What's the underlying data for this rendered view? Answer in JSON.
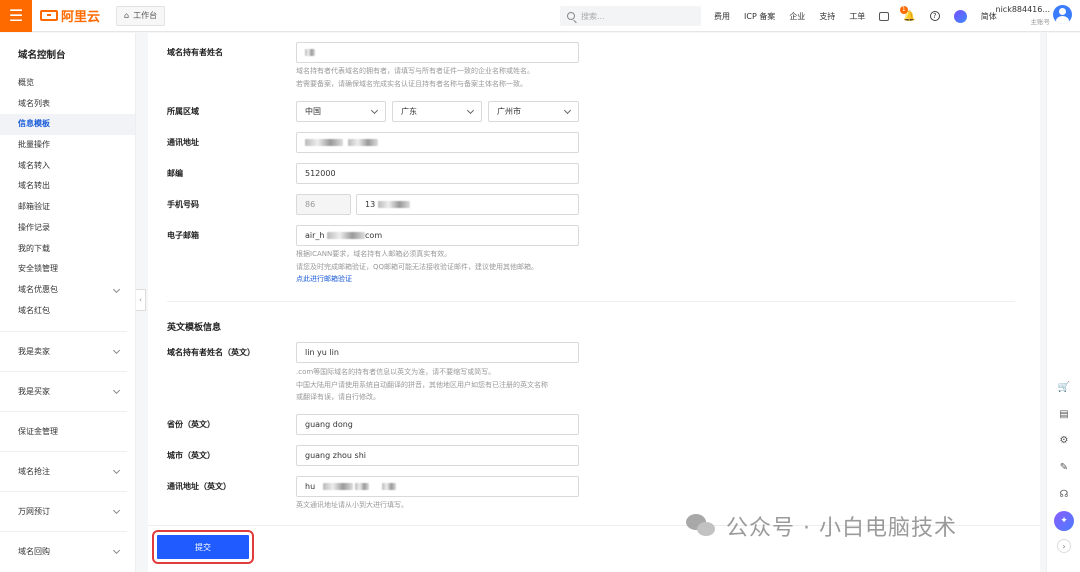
{
  "topbar": {
    "logo_text": "阿里云",
    "workbench": "工作台",
    "search_placeholder": "搜索...",
    "links": [
      "费用",
      "ICP 备案",
      "企业",
      "支持",
      "工单"
    ],
    "notification_count": "1",
    "lang": "简体",
    "user_name": "nick884416...",
    "user_role": "主账号"
  },
  "sidebar": {
    "title": "域名控制台",
    "items": [
      "概览",
      "域名列表",
      "信息模板",
      "批量操作",
      "域名转入",
      "域名转出",
      "邮箱验证",
      "操作记录",
      "我的下载",
      "安全锁管理",
      "域名优惠包",
      "域名红包"
    ],
    "active_item": "信息模板",
    "groups": [
      "我是卖家",
      "我是买家",
      "保证金管理",
      "域名抢注",
      "万网预订",
      "域名回购"
    ]
  },
  "form": {
    "owner_name_label": "域名持有者姓名",
    "owner_name_help": [
      "域名持有者代表域名的拥有者，请填写与所有者证件一致的企业名称或姓名。",
      "若需要备案，请确保域名完成实名认证且持有者名称与备案主体名称一致。"
    ],
    "region_label": "所属区域",
    "country": "中国",
    "province": "广东",
    "city": "广州市",
    "address_label": "通讯地址",
    "postcode_label": "邮编",
    "postcode": "512000",
    "phone_label": "手机号码",
    "phone_code": "86",
    "phone_prefix": "13",
    "email_label": "电子邮箱",
    "email_prefix": "air_h",
    "email_suffix": "com",
    "email_help": [
      "根据ICANN要求，域名持有人邮箱必须真实有效。",
      "请您及时完成邮箱验证，QQ邮箱可能无法接收验证邮件，建议使用其他邮箱。"
    ],
    "email_verify_link": "点此进行邮箱验证"
  },
  "english": {
    "section_title": "英文模板信息",
    "owner_name_label": "域名持有者姓名（英文）",
    "owner_name": "lin yu lin",
    "owner_help": [
      ".com等国际域名的持有者信息以英文为准，请不要缩写或简写。",
      "中国大陆用户请使用系统自动翻译的拼音，其他地区用户如您有已注册的英文名称",
      "或翻译有误，请自行修改。"
    ],
    "province_label": "省份（英文）",
    "province": "guang dong",
    "city_label": "城市（英文）",
    "city": "guang zhou shi",
    "address_label": "通讯地址（英文）",
    "address_prefix": "hu",
    "address_help": "英文通讯地址请从小到大进行填写。"
  },
  "actions": {
    "submit": "提交"
  },
  "watermark": "公众号 · 小白电脑技术",
  "colors": {
    "brand": "#ff6a00",
    "primary": "#1f5bff",
    "link": "#1a5cd8",
    "highlight_box": "#e03c3c"
  }
}
